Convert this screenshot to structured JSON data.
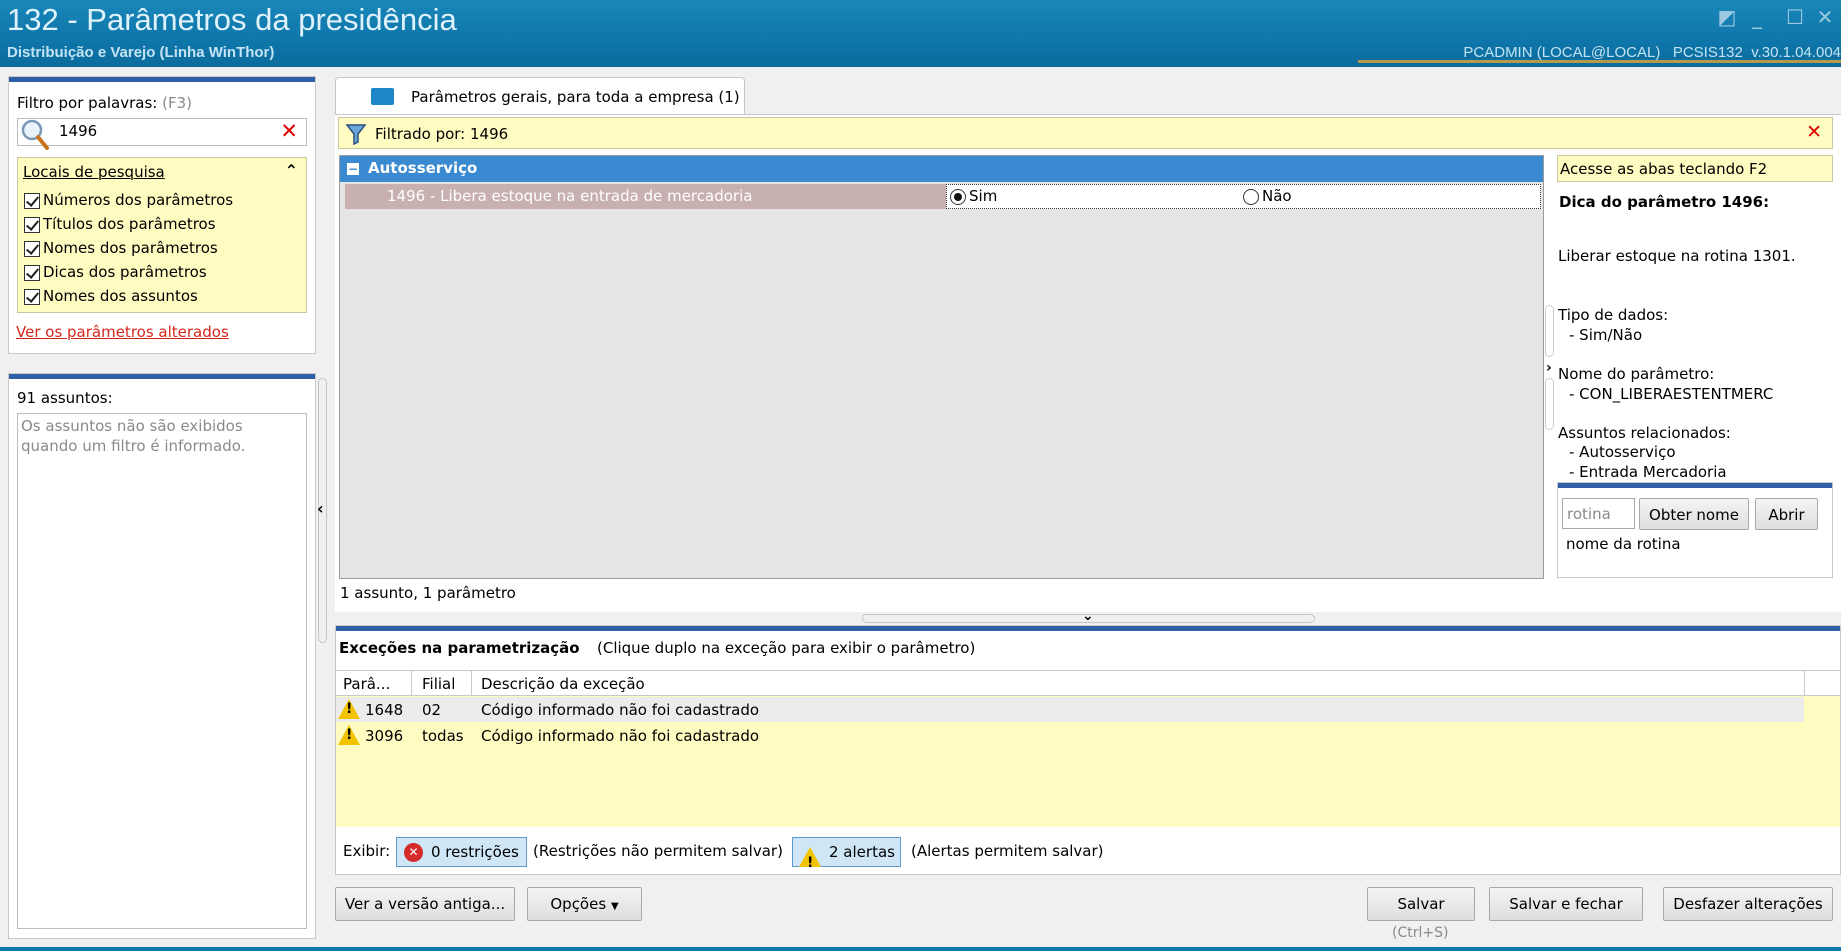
{
  "window": {
    "title": "132 - Parâmetros da presidência",
    "subtitle": "Distribuição e Varejo (Linha WinThor)",
    "info": "PCADMIN (LOCAL@LOCAL)   PCSIS132  v.30.1.04.004"
  },
  "filter": {
    "label": "Filtro por palavras:",
    "shortcut": "(F3)",
    "value": "1496",
    "locations_title": "Locais de pesquisa",
    "options": [
      {
        "label": "Números dos parâmetros",
        "checked": true
      },
      {
        "label": "Títulos dos parâmetros",
        "checked": true
      },
      {
        "label": "Nomes dos parâmetros",
        "checked": true
      },
      {
        "label": "Dicas dos parâmetros",
        "checked": true
      },
      {
        "label": "Nomes dos assuntos",
        "checked": true
      }
    ],
    "changed_link": "Ver os parâmetros alterados"
  },
  "subjects": {
    "count_label": "91 assuntos:",
    "note": "Os assuntos não são exibidos quando um filtro é informado."
  },
  "tab": {
    "label": "Parâmetros gerais, para toda a empresa  (1)"
  },
  "filtered": {
    "text": "Filtrado por: 1496"
  },
  "group": {
    "title": "Autosserviço",
    "param_label": "1496 - Libera estoque na entrada de mercadoria",
    "option_yes": "Sim",
    "option_no": "Não",
    "selected": "Sim"
  },
  "summary": "1 assunto, 1 parâmetro",
  "hint": {
    "tabs_tip": "Acesse as abas teclando F2",
    "title": "Dica do parâmetro 1496:",
    "description": "Liberar estoque na rotina 1301.",
    "type_label": "Tipo de dados:",
    "type_value": "- Sim/Não",
    "name_label": "Nome do parâmetro:",
    "name_value": "- CON_LIBERAESTENTMERC",
    "related_label": "Assuntos relacionados:",
    "related": [
      "- Autosserviço",
      "- Entrada Mercadoria"
    ]
  },
  "routine": {
    "placeholder": "rotina",
    "get_name": "Obter nome",
    "open": "Abrir",
    "name_label": "nome da rotina"
  },
  "exceptions": {
    "title": "Exceções na parametrização",
    "hint": "(Clique duplo na exceção para exibir o parâmetro)",
    "columns": [
      "Parâ...",
      "Filial",
      "Descrição da exceção"
    ],
    "rows": [
      {
        "param": "1648",
        "branch": "02",
        "description": "Código informado não foi cadastrado"
      },
      {
        "param": "3096",
        "branch": "todas",
        "description": "Código informado não foi cadastrado"
      }
    ],
    "show_label": "Exibir:",
    "restrictions_btn": "0 restrições",
    "restrictions_note": "(Restrições não permitem salvar)",
    "alerts_btn": "2 alertas",
    "alerts_note": "(Alertas permitem salvar)"
  },
  "footer": {
    "old_version": "Ver a versão antiga...",
    "options": "Opções",
    "save": "Salvar",
    "save_shortcut": "(Ctrl+S)",
    "save_close": "Salvar e fechar",
    "undo": "Desfazer alterações"
  },
  "colors": {
    "titlebar": "#0f78ac",
    "accent_blue": "#2f5fa6",
    "group_header": "#3a8ad2",
    "selected_row": "#c9b0b0",
    "yellow": "#fffcc2",
    "link": "#d6261b"
  }
}
